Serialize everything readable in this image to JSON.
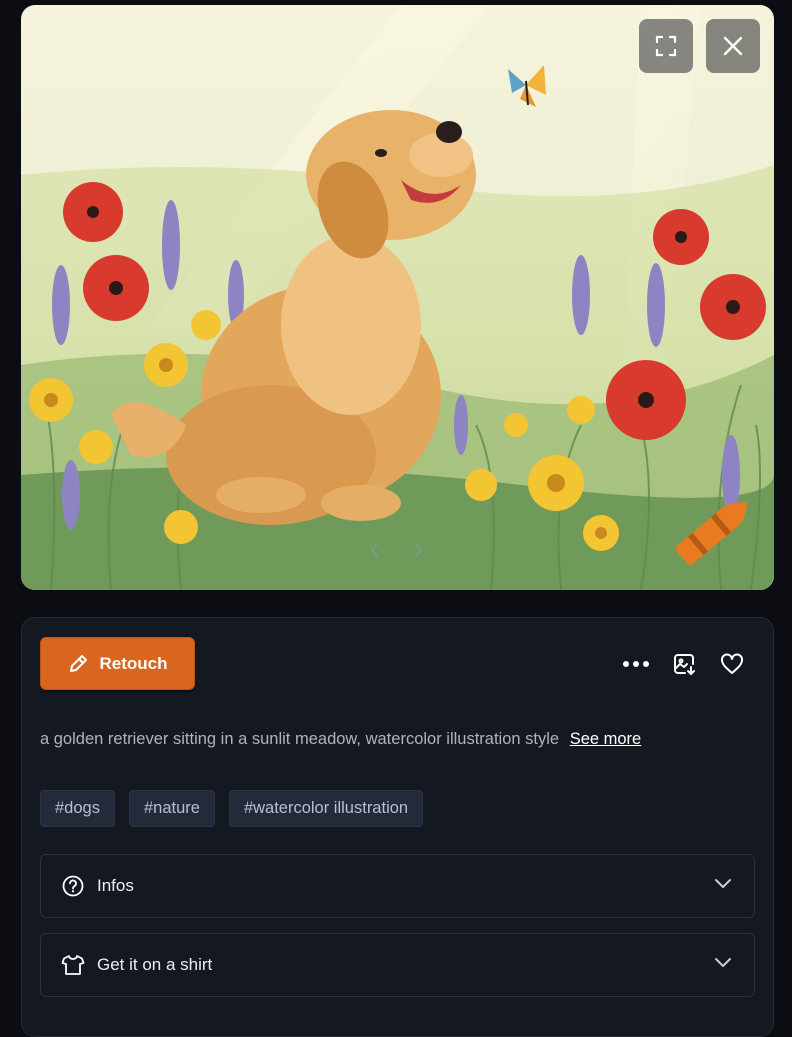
{
  "image": {
    "alt_icons": [
      "expand-icon",
      "close-icon"
    ]
  },
  "panel": {
    "retouch_label": "Retouch",
    "actions": [
      "more-icon",
      "save-image-icon",
      "heart-icon"
    ],
    "prompt": "a golden retriever sitting in a sunlit meadow, watercolor illustration style",
    "see_more": "See more",
    "tags": [
      "#dogs",
      "#nature",
      "#watercolor illustration"
    ],
    "accordions": {
      "infos": "Infos",
      "shirt": "Get it on a shirt"
    }
  },
  "colors": {
    "background": "#0b0d12",
    "panel": "#141821",
    "accent": "#d9661e",
    "tag_bg": "#232a3a"
  }
}
